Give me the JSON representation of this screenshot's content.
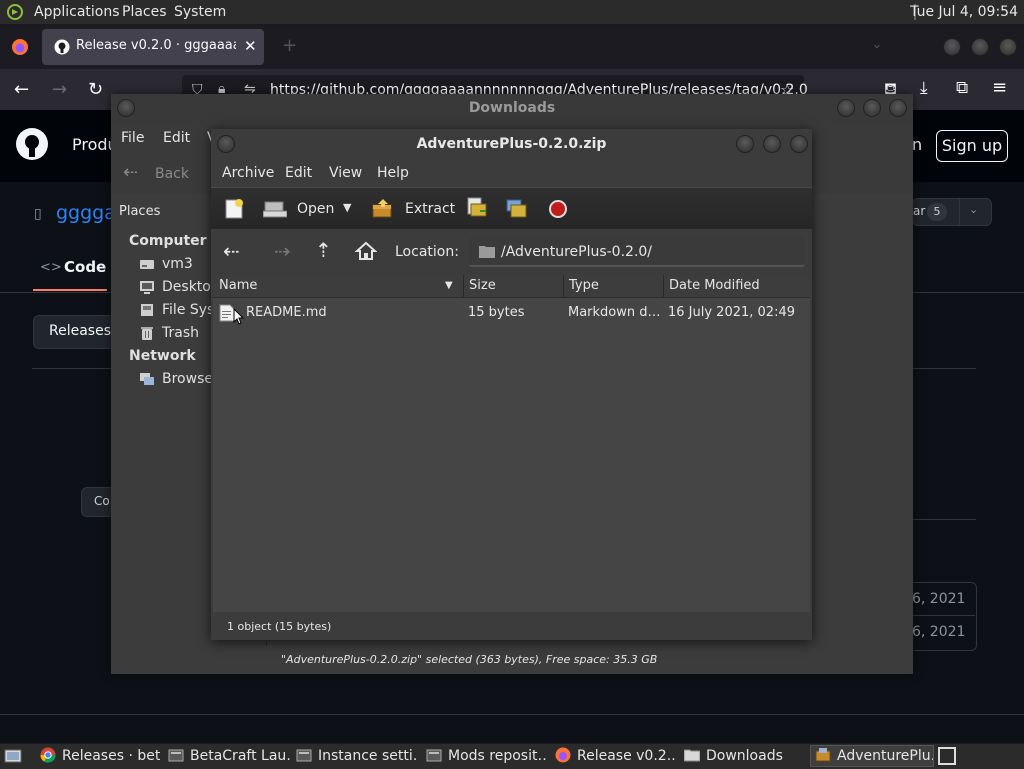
{
  "top_panel": {
    "applications": "Applications",
    "places": "Places",
    "system": "System",
    "clock": "Tue Jul  4, 09:54"
  },
  "firefox": {
    "tab_title": "Release v0.2.0 · gggaaaann",
    "url": "https://github.com/ggggaaaannnnnnnggg/AdventurePlus/releases/tag/v0.2.0"
  },
  "github": {
    "nav_partial": "Produ",
    "sign_in_partial": "n",
    "sign_up": "Sign up",
    "repo_partial": "gggga",
    "star_partial": "ar",
    "star_count": "5",
    "code_tab": "Code",
    "releases_button": "Releases",
    "comment_partial": "Co",
    "date1": "6, 2021",
    "date2": "6, 2021"
  },
  "downloads": {
    "title": "Downloads",
    "menu": [
      "File",
      "Edit",
      "V"
    ],
    "back": "Back",
    "places_label": "Places",
    "sidebar": {
      "computer": "Computer",
      "vm3": "vm3",
      "desktop": "Desktop",
      "filesystem": "File Syst",
      "trash": "Trash",
      "network": "Network",
      "browse": "Browse N"
    },
    "status": "\"AdventurePlus-0.2.0.zip\" selected (363 bytes), Free space: 35.3 GB"
  },
  "archive": {
    "title": "AdventurePlus-0.2.0.zip",
    "menu": [
      "Archive",
      "Edit",
      "View",
      "Help"
    ],
    "toolbar": {
      "open": "Open",
      "extract": "Extract"
    },
    "location_label": "Location:",
    "location_path": "/AdventurePlus-0.2.0/",
    "columns": [
      "Name",
      "Size",
      "Type",
      "Date Modified"
    ],
    "files": [
      {
        "name": "README.md",
        "size": "15 bytes",
        "type": "Markdown d…",
        "date": "16 July 2021, 02:49"
      }
    ],
    "status": "1 object (15 bytes)"
  },
  "taskbar": [
    {
      "label": "Releases · bet…",
      "icon": "chrome-icon"
    },
    {
      "label": "BetaCraft Lau…",
      "icon": "java-icon"
    },
    {
      "label": "Instance setti…",
      "icon": "java-icon"
    },
    {
      "label": "Mods reposit…",
      "icon": "java-icon"
    },
    {
      "label": "Release v0.2.…",
      "icon": "firefox-icon"
    },
    {
      "label": "Downloads",
      "icon": "folder-icon"
    },
    {
      "label": "AdventurePlu…",
      "icon": "archive-icon"
    }
  ],
  "colors": {
    "panel": "#2b2b2b",
    "window": "#3c3c3c",
    "github_bg": "#0d1117",
    "github_header": "#010409",
    "firefox_tabbar": "#1c1b22",
    "record_red": "#c21d1d"
  }
}
